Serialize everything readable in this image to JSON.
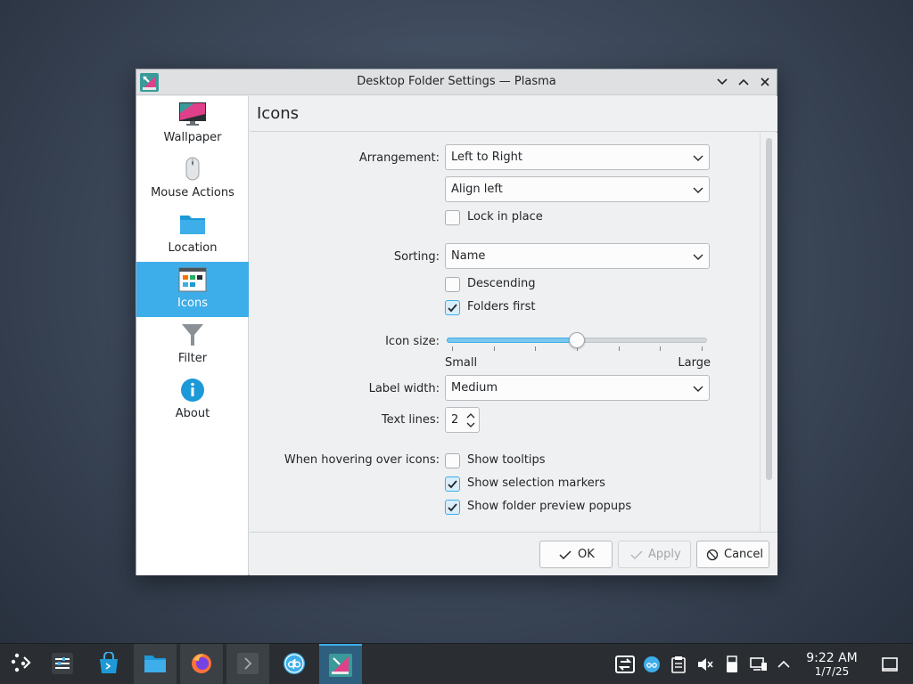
{
  "window": {
    "title": "Desktop Folder Settings — Plasma"
  },
  "sidebar": {
    "items": [
      {
        "label": "Wallpaper",
        "icon": "monitor-icon"
      },
      {
        "label": "Mouse Actions",
        "icon": "mouse-icon"
      },
      {
        "label": "Location",
        "icon": "folder-icon"
      },
      {
        "label": "Icons",
        "icon": "icons-view-icon",
        "active": true
      },
      {
        "label": "Filter",
        "icon": "funnel-icon"
      },
      {
        "label": "About",
        "icon": "info-icon"
      }
    ]
  },
  "page": {
    "title": "Icons"
  },
  "form": {
    "arrangement_label": "Arrangement:",
    "arrangement_value": "Left to Right",
    "alignment_value": "Align left",
    "lock_label": "Lock in place",
    "lock_checked": false,
    "sorting_label": "Sorting:",
    "sorting_value": "Name",
    "descending_label": "Descending",
    "descending_checked": false,
    "folders_first_label": "Folders first",
    "folders_first_checked": true,
    "icon_size_label": "Icon size:",
    "icon_size_min_label": "Small",
    "icon_size_max_label": "Large",
    "icon_size_fraction": 0.5,
    "label_width_label": "Label width:",
    "label_width_value": "Medium",
    "text_lines_label": "Text lines:",
    "text_lines_value": "2",
    "hover_label": "When hovering over icons:",
    "show_tooltips_label": "Show tooltips",
    "show_tooltips_checked": false,
    "selection_markers_label": "Show selection markers",
    "selection_markers_checked": true,
    "folder_preview_label": "Show folder preview popups",
    "folder_preview_checked": true
  },
  "buttons": {
    "ok": "OK",
    "apply": "Apply",
    "cancel": "Cancel"
  },
  "taskbar": {
    "clock_time": "9:22 AM",
    "clock_date": "1/7/25"
  },
  "colors": {
    "accent": "#3daee9",
    "window_bg": "#eff0f1",
    "taskbar_bg": "#2a2e32"
  }
}
